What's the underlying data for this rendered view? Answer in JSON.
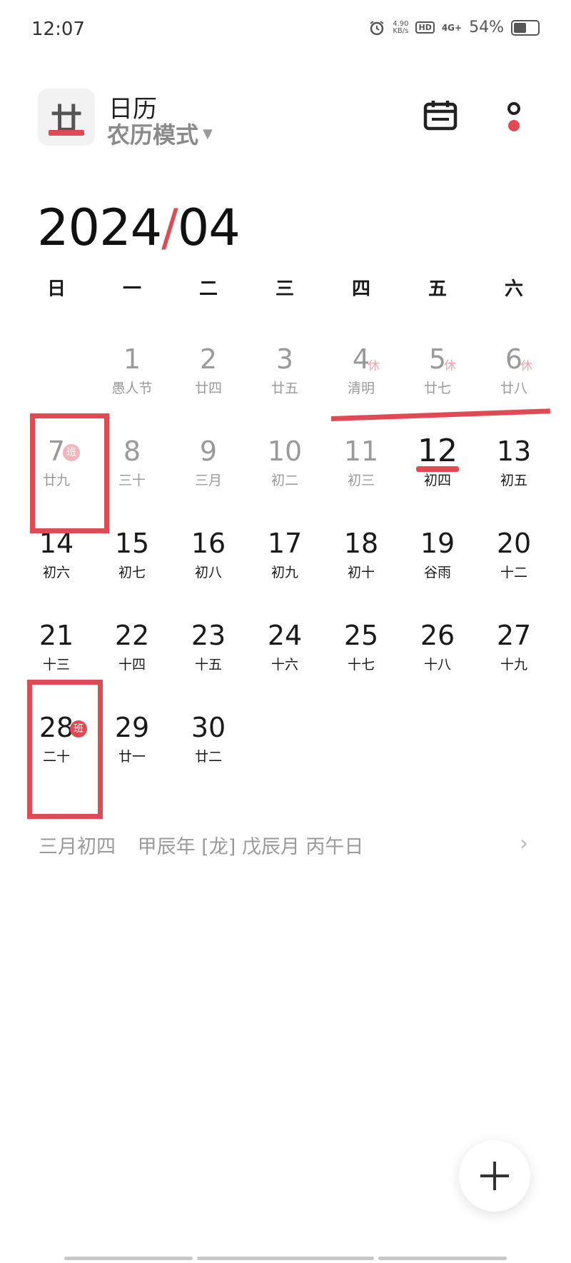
{
  "status": {
    "time": "12:07",
    "net_speed_value": "4.90",
    "net_speed_unit": "KB/s",
    "hd": "HD",
    "signal": "4G+",
    "battery": "54%",
    "battery_level": 0.54
  },
  "header": {
    "logo_char": "廿",
    "title": "日历",
    "mode": "农历模式",
    "icons": [
      "calendar-icon",
      "more-icon"
    ]
  },
  "month_title": {
    "year": "2024",
    "slash": "/",
    "month": "04"
  },
  "weekdays": [
    "日",
    "一",
    "二",
    "三",
    "四",
    "五",
    "六"
  ],
  "days": [
    {
      "num": "1",
      "lunar": "愚人节",
      "state": "past"
    },
    {
      "num": "2",
      "lunar": "廿四",
      "state": "past"
    },
    {
      "num": "3",
      "lunar": "廿五",
      "state": "past"
    },
    {
      "num": "4",
      "lunar": "清明",
      "state": "past",
      "badge": "休"
    },
    {
      "num": "5",
      "lunar": "廿七",
      "state": "past",
      "badge": "休"
    },
    {
      "num": "6",
      "lunar": "廿八",
      "state": "past",
      "badge": "休"
    },
    {
      "num": "7",
      "lunar": "廿九",
      "state": "past",
      "badge": "班"
    },
    {
      "num": "8",
      "lunar": "三十",
      "state": "past"
    },
    {
      "num": "9",
      "lunar": "三月",
      "state": "past"
    },
    {
      "num": "10",
      "lunar": "初二",
      "state": "past"
    },
    {
      "num": "11",
      "lunar": "初三",
      "state": "past"
    },
    {
      "num": "12",
      "lunar": "初四",
      "state": "today"
    },
    {
      "num": "13",
      "lunar": "初五"
    },
    {
      "num": "14",
      "lunar": "初六"
    },
    {
      "num": "15",
      "lunar": "初七"
    },
    {
      "num": "16",
      "lunar": "初八"
    },
    {
      "num": "17",
      "lunar": "初九"
    },
    {
      "num": "18",
      "lunar": "初十"
    },
    {
      "num": "19",
      "lunar": "谷雨"
    },
    {
      "num": "20",
      "lunar": "十二"
    },
    {
      "num": "21",
      "lunar": "十三"
    },
    {
      "num": "22",
      "lunar": "十四"
    },
    {
      "num": "23",
      "lunar": "十五"
    },
    {
      "num": "24",
      "lunar": "十六"
    },
    {
      "num": "25",
      "lunar": "十七"
    },
    {
      "num": "26",
      "lunar": "十八"
    },
    {
      "num": "27",
      "lunar": "十九"
    },
    {
      "num": "28",
      "lunar": "二十",
      "badge": "班"
    },
    {
      "num": "29",
      "lunar": "廿一"
    },
    {
      "num": "30",
      "lunar": "廿二"
    }
  ],
  "info": {
    "lunar_date": "三月初四",
    "ganzhi": "甲辰年 [龙] 戊辰月 丙午日"
  },
  "fab": {
    "label": "+"
  },
  "colors": {
    "accent": "#e04a55",
    "muted": "#9a9a9a",
    "text": "#1a1a1a"
  }
}
